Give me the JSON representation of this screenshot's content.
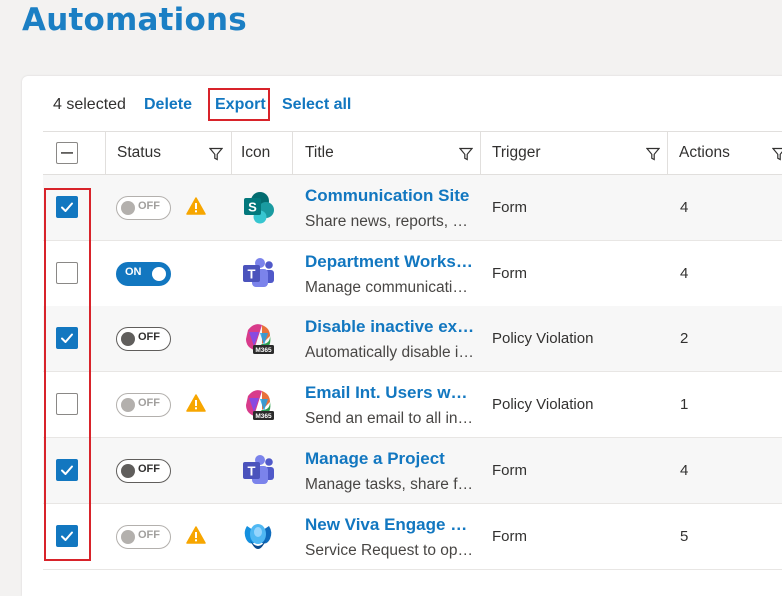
{
  "page": {
    "title": "Automations"
  },
  "toolbar": {
    "selected_count": "4 selected",
    "delete_label": "Delete",
    "export_label": "Export",
    "select_all_label": "Select all"
  },
  "columns": {
    "status": "Status",
    "icon": "Icon",
    "title": "Title",
    "trigger": "Trigger",
    "actions": "Actions"
  },
  "toggle_labels": {
    "on": "ON",
    "off": "OFF"
  },
  "rows": [
    {
      "checked": true,
      "status": "off",
      "warning": true,
      "app": "sharepoint",
      "title": "Communication Site",
      "description": "Share news, reports, status and more",
      "trigger": "Form",
      "actions": "4"
    },
    {
      "checked": false,
      "status": "on",
      "warning": false,
      "app": "teams",
      "title": "Department Workspace",
      "description": "Manage communication and collaboration",
      "trigger": "Form",
      "actions": "4"
    },
    {
      "checked": true,
      "status": "off",
      "warning": false,
      "app": "m365",
      "title": "Disable inactive external users",
      "description": "Automatically disable inactive guests",
      "trigger": "Policy Violation",
      "actions": "2"
    },
    {
      "checked": false,
      "status": "off",
      "warning": true,
      "app": "m365",
      "title": "Email Int. Users who are inactive",
      "description": "Send an email to all inactive users",
      "trigger": "Policy Violation",
      "actions": "1"
    },
    {
      "checked": true,
      "status": "off",
      "warning": false,
      "app": "teams",
      "title": "Manage a Project",
      "description": "Manage tasks, share files and more",
      "trigger": "Form",
      "actions": "4"
    },
    {
      "checked": true,
      "status": "off",
      "warning": true,
      "app": "viva-engage",
      "title": "New Viva Engage Community",
      "description": "Service Request to open a community",
      "trigger": "Form",
      "actions": "5"
    }
  ],
  "colors": {
    "accent": "#1277c0",
    "title": "#1b7fc4",
    "highlight_red": "#d8232a",
    "warning": "#f7a600"
  }
}
